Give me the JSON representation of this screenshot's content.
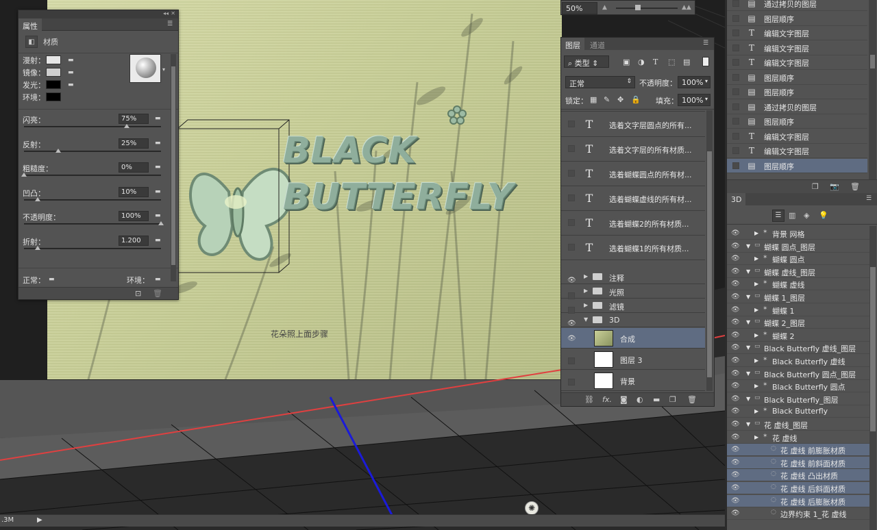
{
  "canvas": {
    "word1": "BLACK",
    "word2": "BUTTERFLY",
    "note": "花朵照上面步骤"
  },
  "properties": {
    "tab": "属性",
    "section": "材质",
    "rows": [
      {
        "label": "漫射：",
        "color": "#e6e6e6"
      },
      {
        "label": "镜像：",
        "color": "#cfcfcf"
      },
      {
        "label": "发光：",
        "color": "#000000"
      },
      {
        "label": "环境：",
        "color": "#000000"
      }
    ],
    "sliders": [
      {
        "label": "闪亮：",
        "value": "75%",
        "fraction": 0.75
      },
      {
        "label": "反射：",
        "value": "25%",
        "fraction": 0.25
      },
      {
        "label": "粗糙度：",
        "value": "0%",
        "fraction": 0.0
      },
      {
        "label": "凹凸：",
        "value": "10%",
        "fraction": 0.1
      },
      {
        "label": "不透明度：",
        "value": "100%",
        "fraction": 1.0
      },
      {
        "label": "折射：",
        "value": "1.200",
        "fraction": 0.1
      }
    ],
    "normal": "正常：",
    "env": "环境："
  },
  "zoom": {
    "value": "50%"
  },
  "layers": {
    "tabs": [
      "图层",
      "通道"
    ],
    "filter_kind": "类型",
    "blend_mode": "正常",
    "opacity_label": "不透明度：",
    "opacity_value": "100%",
    "lock_label": "锁定：",
    "fill_label": "填充：",
    "fill_value": "100%",
    "text_layers": [
      "选着文字层圆点的所有...",
      "选着文字层的所有材质...",
      "选着蝴蝶圆点的所有材...",
      "选着蝴蝶虚线的所有材...",
      "选着蝴蝶2的所有材质...",
      "选着蝴蝶1的所有材质..."
    ],
    "groups": [
      {
        "name": "注释",
        "visible": true
      },
      {
        "name": "光照",
        "visible": false
      },
      {
        "name": "滤镜",
        "visible": false
      },
      {
        "name": "3D",
        "visible": true
      }
    ],
    "pixel_layers": [
      {
        "name": "合成",
        "visible": true,
        "selected": true
      },
      {
        "name": "图层 3",
        "visible": false,
        "selected": false
      },
      {
        "name": "背景",
        "visible": false,
        "selected": false
      }
    ]
  },
  "history": {
    "items": [
      {
        "icon": "doc",
        "label": "通过拷贝的图层"
      },
      {
        "icon": "doc",
        "label": "图层顺序"
      },
      {
        "icon": "T",
        "label": "编辑文字图层"
      },
      {
        "icon": "T",
        "label": "编辑文字图层"
      },
      {
        "icon": "T",
        "label": "编辑文字图层"
      },
      {
        "icon": "doc",
        "label": "图层顺序"
      },
      {
        "icon": "doc",
        "label": "图层顺序"
      },
      {
        "icon": "doc",
        "label": "通过拷贝的图层"
      },
      {
        "icon": "doc",
        "label": "图层顺序"
      },
      {
        "icon": "T",
        "label": "编辑文字图层"
      },
      {
        "icon": "T",
        "label": "编辑文字图层"
      },
      {
        "icon": "doc",
        "label": "图层顺序"
      }
    ]
  },
  "panel3d": {
    "tab": "3D",
    "items": [
      {
        "label": "背景 网格",
        "level": 2,
        "selected": false
      },
      {
        "label": "蝴蝶 圆点_图层",
        "level": 1,
        "selected": false
      },
      {
        "label": "蝴蝶 圆点",
        "level": 2,
        "selected": false
      },
      {
        "label": "蝴蝶 虚线_图层",
        "level": 1,
        "selected": false
      },
      {
        "label": "蝴蝶 虚线",
        "level": 2,
        "selected": false
      },
      {
        "label": "蝴蝶 1_图层",
        "level": 1,
        "selected": false
      },
      {
        "label": "蝴蝶 1",
        "level": 2,
        "selected": false
      },
      {
        "label": "蝴蝶 2_图层",
        "level": 1,
        "selected": false
      },
      {
        "label": "蝴蝶 2",
        "level": 2,
        "selected": false
      },
      {
        "label": "Black Butterfly 虚线_图层",
        "level": 1,
        "selected": false
      },
      {
        "label": "Black Butterfly 虚线",
        "level": 2,
        "selected": false
      },
      {
        "label": "Black Butterfly 圆点_图层",
        "level": 1,
        "selected": false
      },
      {
        "label": "Black Butterfly 圆点",
        "level": 2,
        "selected": false
      },
      {
        "label": "Black Butterfly_图层",
        "level": 1,
        "selected": false
      },
      {
        "label": "Black Butterfly",
        "level": 2,
        "selected": false
      },
      {
        "label": "花 虚线_图层",
        "level": 1,
        "selected": false
      },
      {
        "label": "花 虚线",
        "level": 2,
        "selected": false
      },
      {
        "label": "花 虚线 前膨胀材质",
        "level": 3,
        "selected": true
      },
      {
        "label": "花 虚线 前斜面材质",
        "level": 3,
        "selected": true
      },
      {
        "label": "花 虚线 凸出材质",
        "level": 3,
        "selected": true
      },
      {
        "label": "花 虚线 后斜面材质",
        "level": 3,
        "selected": true
      },
      {
        "label": "花 虚线 后膨胀材质",
        "level": 3,
        "selected": true
      },
      {
        "label": "边界约束 1_花 虚线",
        "level": 3,
        "selected": false
      }
    ]
  },
  "status": {
    "doc_size": ".3M"
  }
}
